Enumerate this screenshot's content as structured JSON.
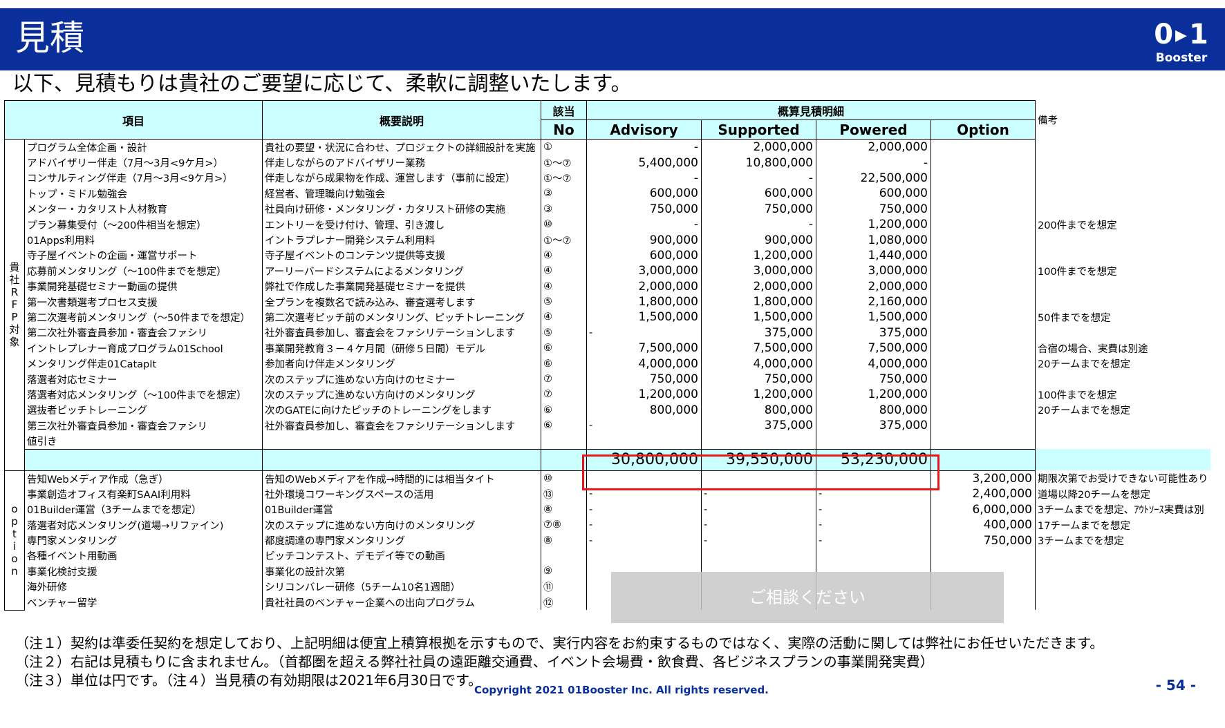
{
  "header": {
    "title": "見積",
    "logo_mark": "0",
    "logo_mark2": "1",
    "logo_word": "Booster"
  },
  "subtitle": "以下、見積もりは貴社のご要望に応じて、柔軟に調整いたします。",
  "table": {
    "headers": {
      "item": "項目",
      "desc": "概要説明",
      "no_top": "該当",
      "no_bottom": "No",
      "estimate": "概算見積明細",
      "advisory": "Advisory",
      "supported": "Supported",
      "powered": "Powered",
      "option": "Option",
      "note": "備考"
    },
    "side_label_rfp": "貴社RFP対象",
    "side_label_option": "option",
    "rows": [
      {
        "item": "プログラム全体企画・設計",
        "desc": "貴社の要望・状況に合わせ、プロジェクトの詳細設計を実施",
        "no": "①",
        "advisory": "-",
        "supported": "2,000,000",
        "powered": "2,000,000",
        "option": "",
        "note": ""
      },
      {
        "item": "アドバイザリー伴走（7月～3月<9ケ月>）",
        "desc": "伴走しながらのアドバイザリー業務",
        "no": "①～⑦",
        "advisory": "5,400,000",
        "supported": "10,800,000",
        "powered": "-",
        "option": "",
        "note": ""
      },
      {
        "item": "コンサルティング伴走（7月～3月<9ケ月>）",
        "desc": "伴走しながら成果物を作成、運営します（事前に設定）",
        "no": "①～⑦",
        "advisory": "-",
        "supported": "-",
        "powered": "22,500,000",
        "option": "",
        "note": ""
      },
      {
        "item": "トップ・ミドル勉強会",
        "desc": "経営者、管理職向け勉強会",
        "no": "③",
        "advisory": "600,000",
        "supported": "600,000",
        "powered": "600,000",
        "option": "",
        "note": ""
      },
      {
        "item": "メンター・カタリスト人材教育",
        "desc": "社員向け研修・メンタリング・カタリスト研修の実施",
        "no": "③",
        "advisory": "750,000",
        "supported": "750,000",
        "powered": "750,000",
        "option": "",
        "note": ""
      },
      {
        "item": "プラン募集受付（～200件相当を想定）",
        "desc": "エントリーを受け付け、管理、引き渡し",
        "no": "⑩",
        "advisory": "-",
        "supported": "-",
        "powered": "1,200,000",
        "option": "",
        "note": "200件までを想定"
      },
      {
        "item": "01Apps利用料",
        "desc": "イントラプレナー開発システム利用料",
        "no": "①～⑦",
        "advisory": "900,000",
        "supported": "900,000",
        "powered": "1,080,000",
        "option": "",
        "note": ""
      },
      {
        "item": "寺子屋イベントの企画・運営サポート",
        "desc": "寺子屋イベントのコンテンツ提供等支援",
        "no": "④",
        "advisory": "600,000",
        "supported": "1,200,000",
        "powered": "1,440,000",
        "option": "",
        "note": ""
      },
      {
        "item": "応募前メンタリング（～100件までを想定）",
        "desc": "アーリーバードシステムによるメンタリング",
        "no": "④",
        "advisory": "3,000,000",
        "supported": "3,000,000",
        "powered": "3,000,000",
        "option": "",
        "note": "100件までを想定"
      },
      {
        "item": "事業開発基礎セミナー動画の提供",
        "desc": "弊社で作成した事業開発基礎セミナーを提供",
        "no": "④",
        "advisory": "2,000,000",
        "supported": "2,000,000",
        "powered": "2,000,000",
        "option": "",
        "note": ""
      },
      {
        "item": "第一次書類選考プロセス支援",
        "desc": "全プランを複数名で読み込み、審査選考します",
        "no": "⑤",
        "advisory": "1,800,000",
        "supported": "1,800,000",
        "powered": "2,160,000",
        "option": "",
        "note": ""
      },
      {
        "item": "第二次選考前メンタリング（～50件までを想定）",
        "desc": "第二次選考ピッチ前のメンタリング、ピッチトレーニング",
        "no": "④",
        "advisory": "1,500,000",
        "supported": "1,500,000",
        "powered": "1,500,000",
        "option": "",
        "note": "50件までを想定"
      },
      {
        "item": "第二次社外審査員参加・審査会ファシリ",
        "desc": "社外審査員参加し、審査会をファシリテーションします",
        "no": "⑤",
        "advisory": "-",
        "supported": "375,000",
        "powered": "375,000",
        "option": "",
        "note": ""
      },
      {
        "item": "イントレプレナー育成プログラム01School",
        "desc": "事業開発教育３－４ケ月間（研修５日間）モデル",
        "no": "⑥",
        "advisory": "7,500,000",
        "supported": "7,500,000",
        "powered": "7,500,000",
        "option": "",
        "note": "合宿の場合、実費は別途"
      },
      {
        "item": "メンタリング伴走01CatapIt",
        "desc": "参加者向け伴走メンタリング",
        "no": "⑥",
        "advisory": "4,000,000",
        "supported": "4,000,000",
        "powered": "4,000,000",
        "option": "",
        "note": "20チームまでを想定"
      },
      {
        "item": "落選者対応セミナー",
        "desc": "次のステップに進めない方向けのセミナー",
        "no": "⑦",
        "advisory": "750,000",
        "supported": "750,000",
        "powered": "750,000",
        "option": "",
        "note": ""
      },
      {
        "item": "落選者対応メンタリング（～100件までを想定）",
        "desc": "次のステップに進めない方向けのメンタリング",
        "no": "⑦",
        "advisory": "1,200,000",
        "supported": "1,200,000",
        "powered": "1,200,000",
        "option": "",
        "note": "100件までを想定"
      },
      {
        "item": "選抜者ピッチトレーニング",
        "desc": "次のGATEに向けたピッチのトレーニングをします",
        "no": "⑥",
        "advisory": "800,000",
        "supported": "800,000",
        "powered": "800,000",
        "option": "",
        "note": "20チームまでを想定"
      },
      {
        "item": "第三次社外審査員参加・審査会ファシリ",
        "desc": "社外審査員参加し、審査会をファシリテーションします",
        "no": "⑥",
        "advisory": "-",
        "supported": "375,000",
        "powered": "375,000",
        "option": "",
        "note": ""
      },
      {
        "item": "値引き",
        "desc": "",
        "no": "",
        "advisory": "",
        "supported": "",
        "powered": "",
        "option": "",
        "note": ""
      }
    ],
    "totals": {
      "advisory": "30,800,000",
      "supported": "39,550,000",
      "powered": "53,230,000"
    },
    "option_rows": [
      {
        "item": "告知Webメディア作成（急ぎ）",
        "desc": "告知のWebメディアを作成→時間的には相当タイト",
        "no": "⑩",
        "advisory": "",
        "supported": "",
        "powered": "",
        "option": "3,200,000",
        "note": "期限次第でお受けできない可能性あり"
      },
      {
        "item": "事業創造オフィス有楽町SAAI利用料",
        "desc": "社外環境コワーキングスペースの活用",
        "no": "⑬",
        "advisory": "-",
        "supported": "-",
        "powered": "-",
        "option": "2,400,000",
        "note": "道場以降20チームを想定"
      },
      {
        "item": "01Builder運営（3チームまでを想定）",
        "desc": "01Builder運営",
        "no": "⑧",
        "advisory": "-",
        "supported": "-",
        "powered": "-",
        "option": "6,000,000",
        "note": "3チームまでを想定、ｱｳﾄｿｰｽ実費は別"
      },
      {
        "item": "落選者対応メンタリング(道場→リファイン)",
        "desc": "次のステップに進めない方向けのメンタリング",
        "no": "⑦⑧",
        "advisory": "-",
        "supported": "-",
        "powered": "-",
        "option": "400,000",
        "note": "17チームまでを想定"
      },
      {
        "item": "専門家メンタリング",
        "desc": "都度調達の専門家メンタリング",
        "no": "⑧",
        "advisory": "-",
        "supported": "-",
        "powered": "-",
        "option": "750,000",
        "note": "3チームまでを想定"
      },
      {
        "item": "各種イベント用動画",
        "desc": "ピッチコンテスト、デモデイ等での動画",
        "no": "",
        "advisory": "",
        "supported": "",
        "powered": "",
        "option": "",
        "note": ""
      },
      {
        "item": "事業化検討支援",
        "desc": "事業化の設計次第",
        "no": "⑨",
        "advisory": "",
        "supported": "",
        "powered": "",
        "option": "",
        "note": ""
      },
      {
        "item": "海外研修",
        "desc": "シリコンバレー研修（5チーム10名1週間）",
        "no": "⑪",
        "advisory": "",
        "supported": "",
        "powered": "",
        "option": "",
        "note": ""
      },
      {
        "item": "ベンチャー留学",
        "desc": "貴社社員のベンチャー企業への出向プログラム",
        "no": "⑫",
        "advisory": "",
        "supported": "",
        "powered": "",
        "option": "",
        "note": ""
      }
    ],
    "consult_label": "ご相談ください"
  },
  "footnotes": [
    "（注１）契約は準委任契約を想定しており、上記明細は便宜上積算根拠を示すもので、実行内容をお約束するものではなく、実際の活動に関しては弊社にお任せいただきます。",
    "（注２）右記は見積もりに含まれません。（首都圏を超える弊社社員の遠距離交通費、イベント会場費・飲食費、各ビジネスプランの事業開発実費）",
    "（注３）単位は円です。（注４）当見積の有効期限は2021年6月30日です。"
  ],
  "copyright": "Copyright 2021 01Booster Inc.  All rights reserved.",
  "page_number": "- 54 -",
  "colors": {
    "header_bg": "#0b2f9a",
    "table_header_bg": "#ccffff",
    "highlight": "#e8151b"
  }
}
